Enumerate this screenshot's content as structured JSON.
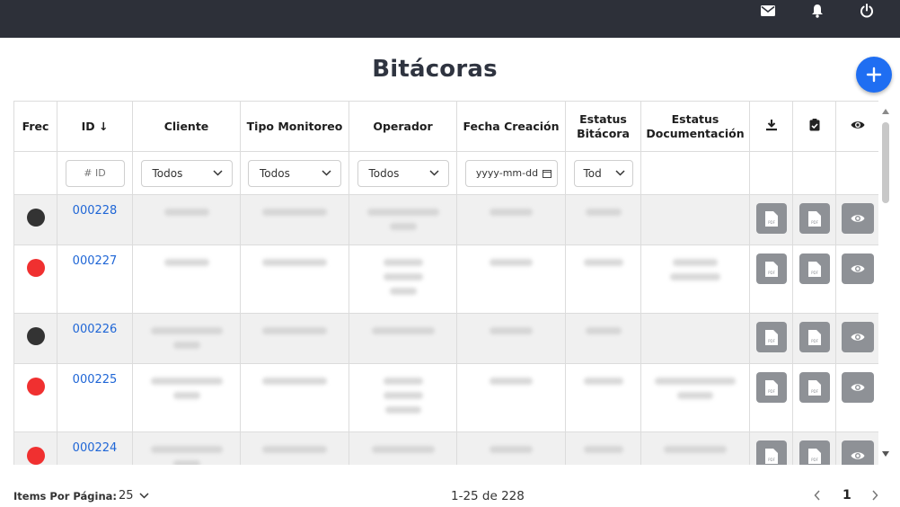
{
  "header": {
    "icons": [
      "mail-icon",
      "bell-icon",
      "power-icon"
    ]
  },
  "page": {
    "title": "Bitácoras",
    "add_icon": "plus-icon",
    "accent_color": "#1f6ef2"
  },
  "table": {
    "columns": [
      "Frec",
      "ID ↓",
      "Cliente",
      "Tipo Monitoreo",
      "Operador",
      "Fecha Creación",
      "Estatus Bitácora",
      "Estatus Documentación"
    ],
    "column_labels": {
      "frec": "Frec",
      "id": "ID ↓",
      "cliente": "Cliente",
      "tipo": "Tipo Monitoreo",
      "operador": "Operador",
      "fecha": "Fecha Creación",
      "estatus_bitacora_1": "Estatus",
      "estatus_bitacora_2": "Bitácora",
      "estatus_doc_1": "Estatus",
      "estatus_doc_2": "Documentación"
    },
    "action_column_icons": [
      "download-icon",
      "clipboard-check-icon",
      "eye-icon"
    ],
    "filters": {
      "id_placeholder": "# ID",
      "cliente": "Todos",
      "tipo": "Todos",
      "operador": "Todos",
      "fecha_placeholder": "yyyy-mm-dd",
      "estatus": "Tod"
    },
    "rows": [
      {
        "id": "000228",
        "frec_color": "#333333"
      },
      {
        "id": "000227",
        "frec_color": "#f03030"
      },
      {
        "id": "000226",
        "frec_color": "#333333"
      },
      {
        "id": "000225",
        "frec_color": "#f03030"
      },
      {
        "id": "000224",
        "frec_color": "#f03030"
      }
    ]
  },
  "footer": {
    "items_per_page_label": "Items Por Página:",
    "items_per_page_value": "25",
    "range": "1-25 de 228",
    "current_page": "1"
  }
}
